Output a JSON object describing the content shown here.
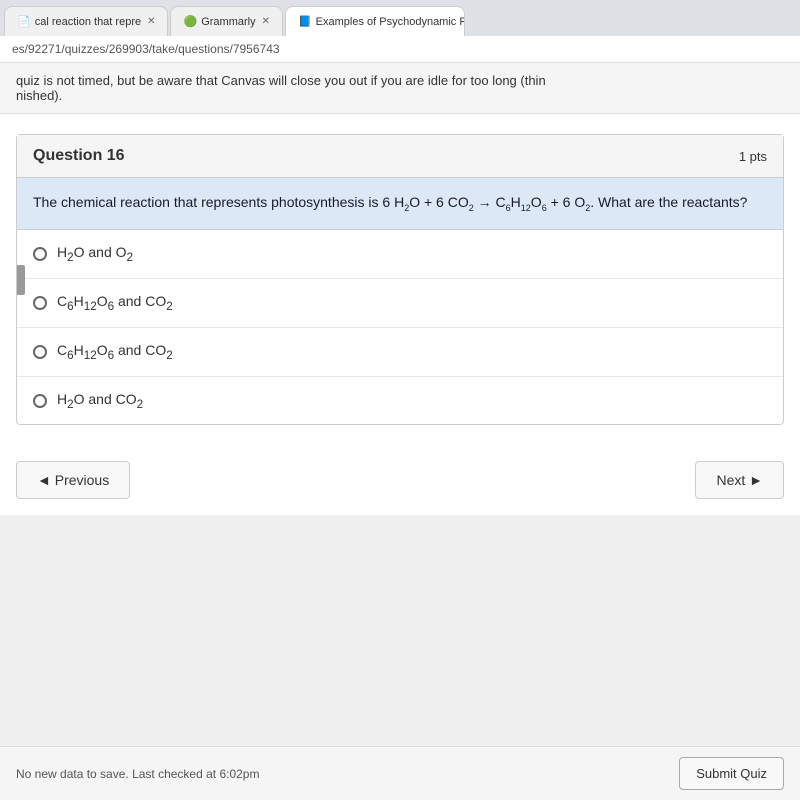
{
  "browser": {
    "tabs": [
      {
        "label": "cal reaction that repre",
        "active": false,
        "icon": "📄",
        "closable": true
      },
      {
        "label": "Grammarly",
        "active": false,
        "icon": "G",
        "closable": true
      },
      {
        "label": "Examples of Psychodynamic P...",
        "active": true,
        "icon": "Y",
        "closable": true
      }
    ],
    "address": "es/92271/quizzes/269903/take/questions/7956743"
  },
  "notice": {
    "text": "quiz is not timed, but be aware that Canvas will close you out if you are idle for too long (thin",
    "text2": "nished)."
  },
  "question": {
    "number": "Question 16",
    "points": "1 pts",
    "prompt": "The chemical reaction that represents photosynthesis is 6 H₂O + 6 CO₂ → C₆H₁₂O₆ + 6 O₂. What are the reactants?",
    "options": [
      {
        "id": "a",
        "label": "H₂O and O₂"
      },
      {
        "id": "b",
        "label": "C₆H₁₂O₆ and CO₂"
      },
      {
        "id": "c",
        "label": "C₆H₁₂O₆ and CO₂"
      },
      {
        "id": "d",
        "label": "H₂O and CO₂"
      }
    ]
  },
  "navigation": {
    "previous_label": "◄ Previous",
    "next_label": "Next ►"
  },
  "footer": {
    "status": "No new data to save. Last checked at 6:02pm",
    "submit_label": "Submit Quiz"
  }
}
